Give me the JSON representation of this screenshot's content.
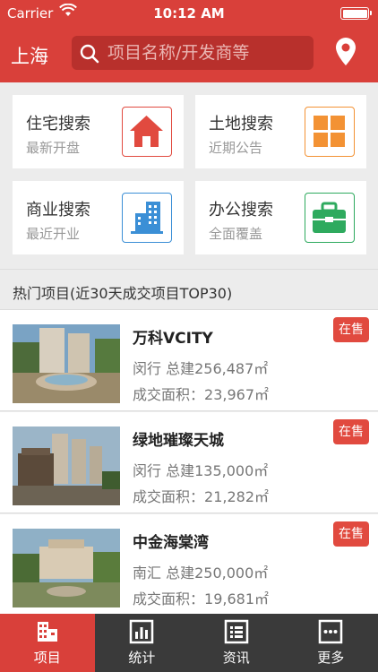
{
  "status_bar": {
    "carrier": "Carrier",
    "time": "10:12 AM"
  },
  "header": {
    "city": "上海",
    "search_placeholder": "项目名称/开发商等"
  },
  "categories": [
    {
      "title": "住宅搜索",
      "subtitle": "最新开盘",
      "icon": "house-icon",
      "color": "#e14a3f"
    },
    {
      "title": "土地搜索",
      "subtitle": "近期公告",
      "icon": "land-grid-icon",
      "color": "#f39234"
    },
    {
      "title": "商业搜索",
      "subtitle": "最近开业",
      "icon": "building-icon",
      "color": "#3b8fd6"
    },
    {
      "title": "办公搜索",
      "subtitle": "全面覆盖",
      "icon": "briefcase-icon",
      "color": "#2eaa5e"
    }
  ],
  "hot_section": {
    "title": "热门项目(近30天成交项目TOP30)"
  },
  "projects": [
    {
      "name": "万科VCITY",
      "district": "闵行",
      "total_label": "总建",
      "total_area": "256,487",
      "unit": "㎡",
      "deal_label": "成交面积：",
      "deal_area": "23,967",
      "status": "在售"
    },
    {
      "name": "绿地璀璨天城",
      "district": "闵行",
      "total_label": "总建",
      "total_area": "135,000",
      "unit": "㎡",
      "deal_label": "成交面积：",
      "deal_area": "21,282",
      "status": "在售"
    },
    {
      "name": "中金海棠湾",
      "district": "南汇",
      "total_label": "总建",
      "total_area": "250,000",
      "unit": "㎡",
      "deal_label": "成交面积：",
      "deal_area": "19,681",
      "status": "在售"
    }
  ],
  "tabs": [
    {
      "label": "项目",
      "icon": "building-icon",
      "active": true
    },
    {
      "label": "统计",
      "icon": "chart-icon",
      "active": false
    },
    {
      "label": "资讯",
      "icon": "news-icon",
      "active": false
    },
    {
      "label": "更多",
      "icon": "more-icon",
      "active": false
    }
  ]
}
